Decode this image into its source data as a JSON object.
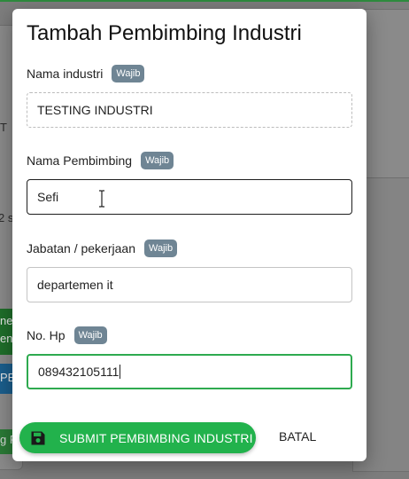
{
  "modal": {
    "title": "Tambah Pembimbing Industri",
    "required_badge": "Wajib",
    "fields": [
      {
        "label": "Nama industri",
        "value": "TESTING INDUSTRI",
        "state": "readonly"
      },
      {
        "label": "Nama Pembimbing",
        "value": "Sefi",
        "state": "hover"
      },
      {
        "label": "Jabatan / pekerjaan",
        "value": "departemen it",
        "state": "normal"
      },
      {
        "label": "No. Hp",
        "value": "089432105111",
        "state": "focused"
      }
    ],
    "submit_label": "SUBMIT PEMBIMBING INDUSTRI",
    "cancel_label": "BATAL"
  },
  "background": {
    "fragments": [
      "T",
      "2 s",
      "ne",
      "en",
      "PE",
      "g F"
    ]
  },
  "colors": {
    "accent_green": "#22b24c",
    "badge": "#6f8594",
    "focus_green": "#2eaa4f"
  },
  "icons": {
    "submit": "save-icon"
  }
}
